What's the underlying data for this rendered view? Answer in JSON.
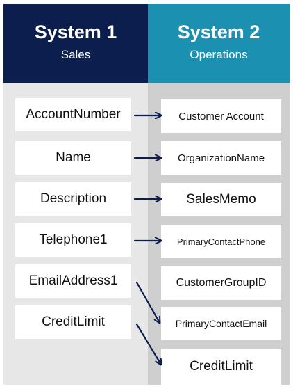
{
  "system1": {
    "title": "System 1",
    "subtitle": "Sales"
  },
  "system2": {
    "title": "System 2",
    "subtitle": "Operations"
  },
  "left_fields": [
    "AccountNumber",
    "Name",
    "Description",
    "Telephone1",
    "EmailAddress1",
    "CreditLimit"
  ],
  "right_fields": [
    "Customer Account",
    "OrganizationName",
    "SalesMemo",
    "PrimaryContactPhone",
    "CustomerGroupID",
    "PrimaryContactEmail",
    "CreditLimit"
  ],
  "mappings": [
    {
      "from": "AccountNumber",
      "to": "Customer Account"
    },
    {
      "from": "Name",
      "to": "OrganizationName"
    },
    {
      "from": "Description",
      "to": "SalesMemo"
    },
    {
      "from": "Telephone1",
      "to": "PrimaryContactPhone"
    },
    {
      "from": "EmailAddress1",
      "to": "PrimaryContactEmail"
    },
    {
      "from": "CreditLimit",
      "to": "CreditLimit"
    }
  ],
  "colors": {
    "system1_header": "#0c1e4e",
    "system2_header": "#1c90b0",
    "arrow": "#0c1e4e"
  }
}
